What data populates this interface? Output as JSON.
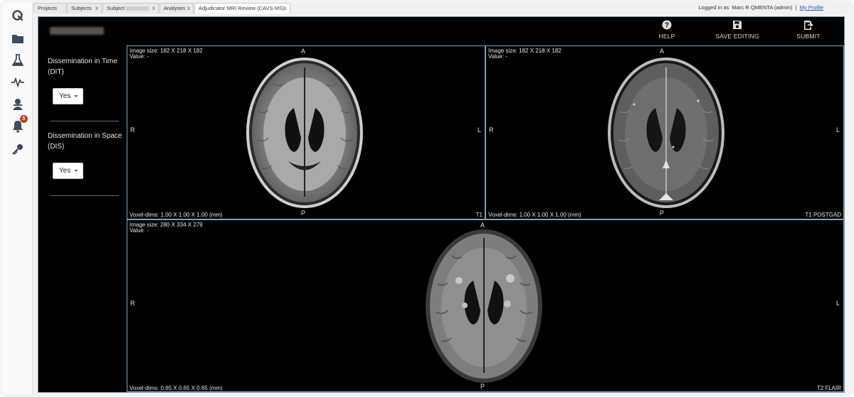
{
  "tabs": [
    {
      "label": "Projects",
      "closable": false
    },
    {
      "label": "Subjects",
      "closable": true
    },
    {
      "label": "Subject",
      "closable": true
    },
    {
      "label": "Analyses",
      "closable": true
    },
    {
      "label": "Adjudicator MRI Review (CAVS-MS)",
      "closable": true,
      "active": true
    }
  ],
  "close_glyph": "x",
  "login": {
    "prefix": "Logged in as",
    "user": "Marc R QMENTA (admin)",
    "separator": "|",
    "profile_link": "My Profile"
  },
  "rail": {
    "icons": [
      "qmenta-logo-icon",
      "folder-icon",
      "flask-icon",
      "pulse-icon",
      "user-icon",
      "bell-icon",
      "key-icon"
    ],
    "notification_count": "5"
  },
  "header": {
    "help_label": "HELP",
    "save_label": "SAVE EDITING",
    "submit_label": "SUBMIT"
  },
  "questions": [
    {
      "label": "Dissemination in Time (DIT)",
      "value": "Yes"
    },
    {
      "label": "Dissemination in Space (DIS)",
      "value": "Yes"
    }
  ],
  "viewers": [
    {
      "image_size": "Image size: 182 X 218 X 182",
      "value": "Value: -",
      "voxel_dims": "Voxel-dims: 1.00 X 1.00 X 1.00 (mm)",
      "sequence": "T1",
      "top": "A",
      "bottom": "P",
      "left": "R",
      "right": "L"
    },
    {
      "image_size": "Image size: 182 X 218 X 182",
      "value": "Value: -",
      "voxel_dims": "Voxel-dims: 1.00 X 1.00 X 1.00 (mm)",
      "sequence": "T1 POSTGAD",
      "top": "A",
      "bottom": "P",
      "left": "R",
      "right": "L"
    },
    {
      "image_size": "Image size: 280 X 334 X 279",
      "value": "Value: -",
      "voxel_dims": "Voxel-dims: 0.65 X 0.65 X 0.65 (mm)",
      "sequence": "T2 FLAIR",
      "top": "A",
      "bottom": "P",
      "left": "R",
      "right": "L"
    }
  ],
  "colors": {
    "frame_border": "#7fa3bf",
    "badge": "#c0392b",
    "link": "#2a56b3"
  }
}
